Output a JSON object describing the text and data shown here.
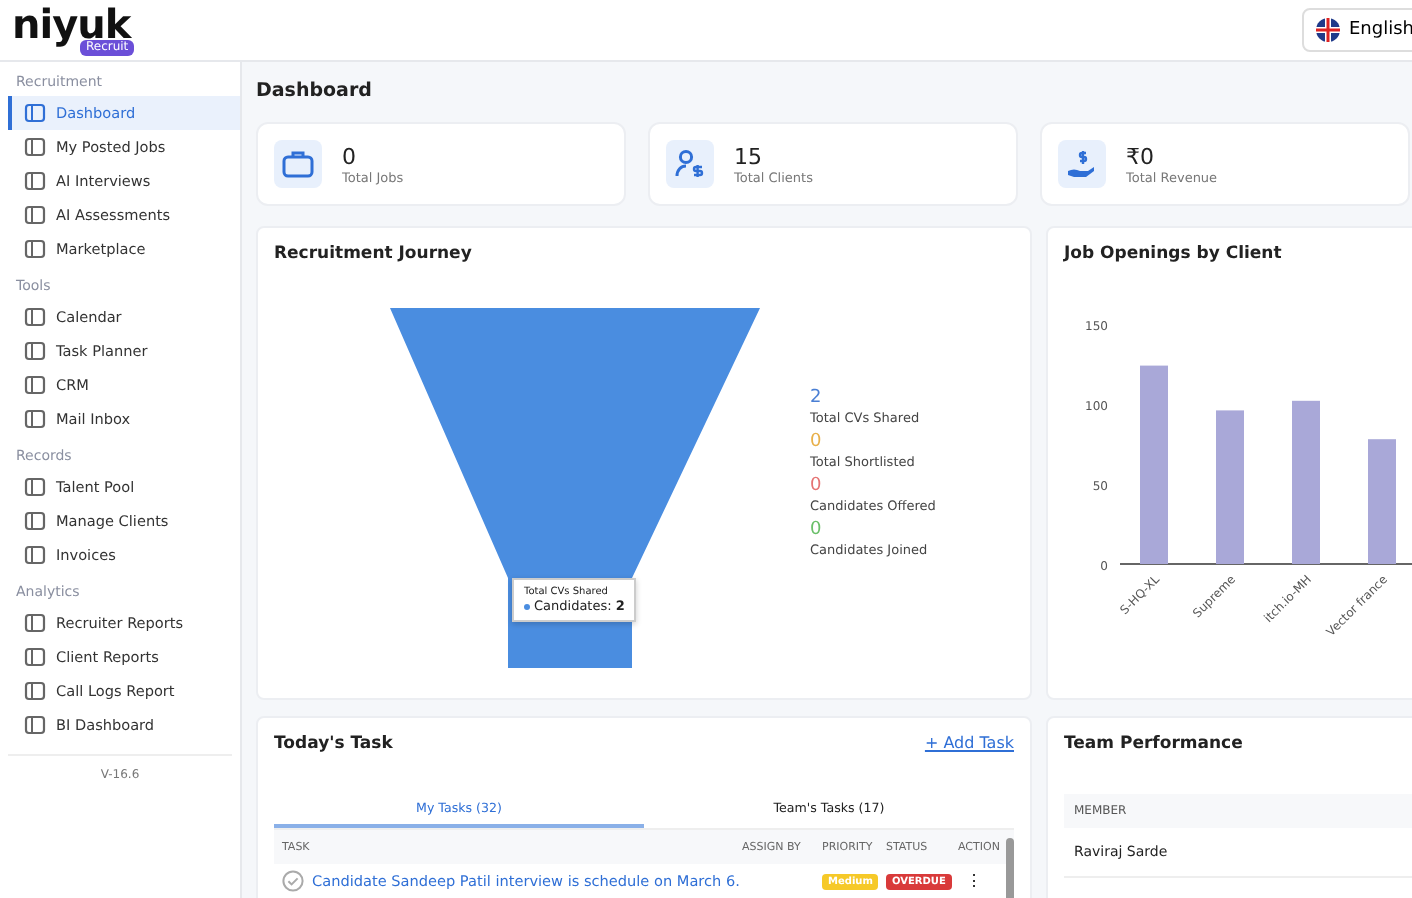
{
  "header": {
    "logo": "niyuk",
    "logo_badge": "Recruit",
    "language": "English"
  },
  "sidebar": {
    "groups": [
      {
        "title": "Recruitment",
        "items": [
          {
            "label": "Dashboard",
            "selected": true
          },
          {
            "label": "My Posted Jobs",
            "selected": false
          },
          {
            "label": "AI Interviews",
            "selected": false
          },
          {
            "label": "AI Assessments",
            "selected": false
          },
          {
            "label": "Marketplace",
            "selected": false
          }
        ]
      },
      {
        "title": "Tools",
        "items": [
          {
            "label": "Calendar",
            "selected": false
          },
          {
            "label": "Task Planner",
            "selected": false
          },
          {
            "label": "CRM",
            "selected": false
          },
          {
            "label": "Mail Inbox",
            "selected": false
          }
        ]
      },
      {
        "title": "Records",
        "items": [
          {
            "label": "Talent Pool",
            "selected": false
          },
          {
            "label": "Manage Clients",
            "selected": false
          },
          {
            "label": "Invoices",
            "selected": false
          }
        ]
      },
      {
        "title": "Analytics",
        "items": [
          {
            "label": "Recruiter Reports",
            "selected": false
          },
          {
            "label": "Client Reports",
            "selected": false
          },
          {
            "label": "Call Logs Report",
            "selected": false
          },
          {
            "label": "BI Dashboard",
            "selected": false
          }
        ]
      }
    ],
    "version": "V-16.6"
  },
  "page_title": "Dashboard",
  "stats": [
    {
      "kind": "jobs",
      "value": "0",
      "label": "Total Jobs"
    },
    {
      "kind": "clients",
      "value": "15",
      "label": "Total Clients"
    },
    {
      "kind": "revenue",
      "value": "₹0",
      "label": "Total Revenue"
    }
  ],
  "journey": {
    "title": "Recruitment Journey",
    "tooltip": {
      "title": "Total CVs Shared",
      "label": "Candidates:",
      "value": "2"
    },
    "metrics": [
      {
        "value": "2",
        "label": "Total CVs Shared",
        "color": "#4a7fd4"
      },
      {
        "value": "0",
        "label": "Total Shortlisted",
        "color": "#e8b04a"
      },
      {
        "value": "0",
        "label": "Candidates Offered",
        "color": "#e57373"
      },
      {
        "value": "0",
        "label": "Candidates Joined",
        "color": "#6abf69"
      }
    ]
  },
  "openings": {
    "title": "Job Openings by Client",
    "chart_data": {
      "type": "bar",
      "categories": [
        "S-HQ-XL",
        "Supreme",
        "itch.io-MH",
        "Vector france"
      ],
      "series": [
        {
          "color": "#a9a8d8",
          "values": [
            124,
            96,
            102,
            78
          ]
        }
      ],
      "ylim": [
        0,
        150
      ],
      "yticks": [
        0,
        50,
        100,
        150
      ]
    }
  },
  "tasks": {
    "title": "Today's Task",
    "add": "+ Add Task",
    "tabs": [
      {
        "label": "My Tasks (32)",
        "selected": true
      },
      {
        "label": "Team's Tasks (17)",
        "selected": false
      }
    ],
    "columns": [
      "TASK",
      "ASSIGN BY",
      "PRIORITY",
      "STATUS",
      "ACTION"
    ],
    "rows": [
      {
        "task": "Candidate Sandeep Patil interview is schedule on March 6.",
        "priority": "Medium",
        "status": "OVERDUE",
        "action": "⋮"
      }
    ]
  },
  "team": {
    "title": "Team Performance",
    "columns": [
      "MEMBER"
    ],
    "rows": [
      "Raviraj Sarde"
    ]
  }
}
